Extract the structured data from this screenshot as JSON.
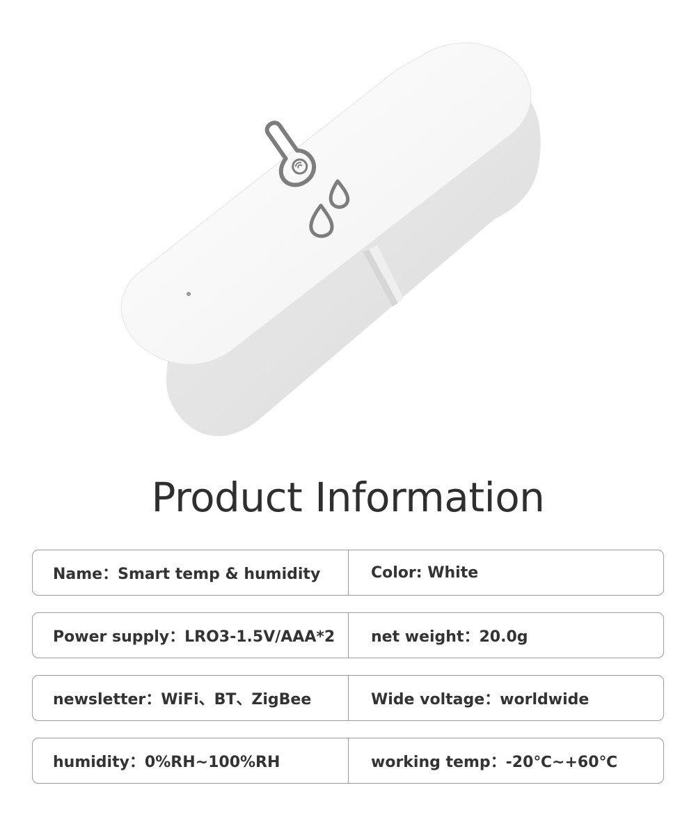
{
  "title": "Product Information",
  "product_image": {
    "description_icon": "thermometer-humidity-icon",
    "color": "#ffffff"
  },
  "specs": [
    {
      "left": "Name：Smart temp & humidity",
      "right": "Color: White"
    },
    {
      "left": "Power supply：LRO3-1.5V/AAA*2",
      "right": "net weight：20.0g"
    },
    {
      "left": "newsletter：WiFi、BT、ZigBee",
      "right": "Wide voltage：worldwide"
    },
    {
      "left": "humidity：0%RH~100%RH",
      "right": "working temp：-20℃~+60℃"
    }
  ]
}
